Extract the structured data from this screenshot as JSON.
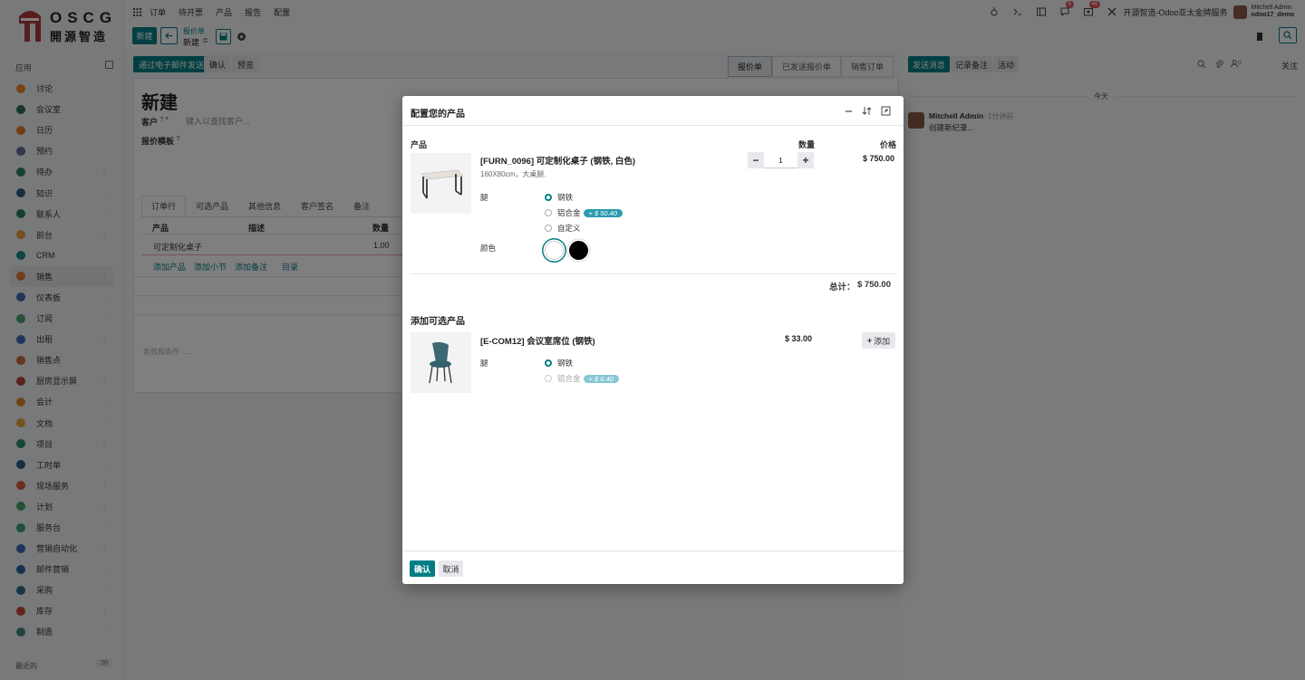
{
  "brand": {
    "name": "OSCG",
    "subtitle": "開源智造"
  },
  "sidebar": {
    "header": "应用",
    "items": [
      {
        "label": "讨论",
        "color": "#e8892b"
      },
      {
        "label": "会议室",
        "color": "#2e6b4f"
      },
      {
        "label": "日历",
        "color": "#e57a32"
      },
      {
        "label": "预约",
        "color": "#5a6f8e"
      },
      {
        "label": "待办",
        "color": "#2a7e63"
      },
      {
        "label": "知识",
        "color": "#2c5f7c"
      },
      {
        "label": "联系人",
        "color": "#2a7e63"
      },
      {
        "label": "前台",
        "color": "#e8a33c"
      },
      {
        "label": "CRM",
        "color": "#1a8a8a"
      },
      {
        "label": "销售",
        "color": "#e07b3a"
      },
      {
        "label": "仪表板",
        "color": "#3e6fb0"
      },
      {
        "label": "订阅",
        "color": "#4a9f6f"
      },
      {
        "label": "出租",
        "color": "#3a6db5"
      },
      {
        "label": "销售点",
        "color": "#c8693a"
      },
      {
        "label": "厨房显示屏",
        "color": "#b04a3a"
      },
      {
        "label": "会计",
        "color": "#d98a2a"
      },
      {
        "label": "文档",
        "color": "#e8a33c"
      },
      {
        "label": "项目",
        "color": "#2a8a6a"
      },
      {
        "label": "工时单",
        "color": "#2c5a8a"
      },
      {
        "label": "现场服务",
        "color": "#d95a3a"
      },
      {
        "label": "计划",
        "color": "#4aa06a"
      },
      {
        "label": "服务台",
        "color": "#3aa07a"
      },
      {
        "label": "营销自动化",
        "color": "#3a6db5"
      },
      {
        "label": "邮件营销",
        "color": "#2a5f9a"
      },
      {
        "label": "采购",
        "color": "#2a6a8a"
      },
      {
        "label": "库存",
        "color": "#c84a3a"
      },
      {
        "label": "制造",
        "color": "#3a8a7a"
      }
    ],
    "footer": {
      "label": "最近的",
      "count": "20"
    }
  },
  "topmenu": {
    "items": [
      "订单",
      "待开票",
      "产品",
      "报告",
      "配置"
    ]
  },
  "topright": {
    "badge1": "8",
    "badge2": "46",
    "company": "开源智造-Odoo亚太金牌服务",
    "user_name": "Mitchell Admin",
    "user_db": "odoo17_demo"
  },
  "control": {
    "new_label": "新建",
    "breadcrumb_parent": "报价单",
    "breadcrumb_current": "新建"
  },
  "actions": {
    "send_email": "通过电子邮件发送",
    "confirm": "确认",
    "preview": "预览"
  },
  "statusbar": [
    "报价单",
    "已发送报价单",
    "销售订单"
  ],
  "form": {
    "title": "新建",
    "customer_label": "客户",
    "customer_placeholder": "键入以查找客户...",
    "template_label": "报价模板",
    "tabs": [
      "订单行",
      "可选产品",
      "其他信息",
      "客户签名",
      "备注"
    ],
    "table_headers": {
      "product": "产品",
      "description": "描述",
      "quantity": "数量"
    },
    "row": {
      "product": "可定制化桌子",
      "quantity": "1.00"
    },
    "add_links": [
      "添加产品",
      "添加小节",
      "添加备注",
      "目录"
    ],
    "terms_placeholder": "条款和条件......"
  },
  "chatter": {
    "send_message": "发送消息",
    "log_note": "记录备注",
    "activity": "活动",
    "follow": "关注",
    "follower_count": "0",
    "day": "今天",
    "author": "Mitchell Admin",
    "time": "- 1分钟前",
    "body": "创建新纪录..."
  },
  "modal": {
    "title": "配置您的产品",
    "col_product": "产品",
    "col_quantity": "数量",
    "col_price": "价格",
    "main": {
      "name": "[FURN_0096] 可定制化桌子 (钢铁, 白色)",
      "description": "160X80cm，大桌腿.",
      "quantity": "1",
      "price": "$ 750.00",
      "attr_legs": "腿",
      "legs_options": [
        {
          "label": "钢铁",
          "extra": ""
        },
        {
          "label": "铝合金",
          "extra": "+ $ 50.40"
        },
        {
          "label": "自定义",
          "extra": ""
        }
      ],
      "attr_color": "颜色",
      "colors": [
        "#ffffff",
        "#000000"
      ]
    },
    "total_label": "总计：",
    "total_value": "$ 750.00",
    "optional_title": "添加可选产品",
    "optional": {
      "name": "[E-COM12] 会议室席位 (钢铁)",
      "price": "$ 33.00",
      "add_label": "添加",
      "attr_legs": "腿",
      "legs_options": [
        {
          "label": "钢铁",
          "extra": ""
        },
        {
          "label": "铝合金",
          "extra": "+ $ 6.40"
        }
      ]
    },
    "confirm": "确认",
    "cancel": "取消"
  }
}
